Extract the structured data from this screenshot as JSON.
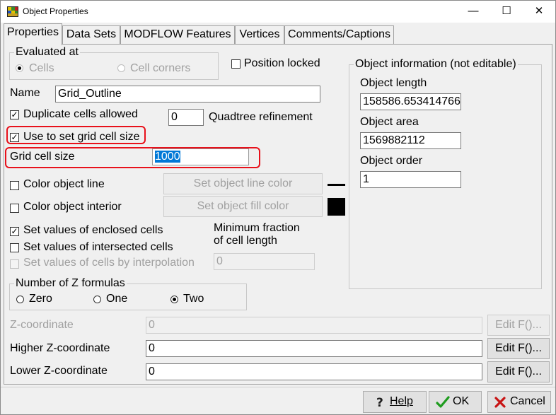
{
  "window": {
    "title": "Object Properties",
    "minimize": "—",
    "maximize": "☐",
    "close": "✕"
  },
  "tabs": [
    "Properties",
    "Data Sets",
    "MODFLOW Features",
    "Vertices",
    "Comments/Captions"
  ],
  "evaluated_at": {
    "title": "Evaluated at",
    "option_cells": "Cells",
    "option_corners": "Cell corners"
  },
  "position_locked": "Position locked",
  "name_label": "Name",
  "name_value": "Grid_Outline",
  "duplicate_cells": "Duplicate cells allowed",
  "quadtree_value": "0",
  "quadtree_label": "Quadtree refinement",
  "use_grid_cell_size": "Use to set grid cell size",
  "grid_cell_size_label": "Grid cell size",
  "grid_cell_size_value": "1000",
  "color_line_label": "Color object line",
  "set_line_color": "Set object line color",
  "color_interior_label": "Color object interior",
  "set_fill_color": "Set object fill color",
  "set_enclosed": "Set values of enclosed cells",
  "set_intersected": "Set values of intersected cells",
  "set_interpolation": "Set values of cells by interpolation",
  "min_fraction_label_1": "Minimum fraction",
  "min_fraction_label_2": "of cell length",
  "min_fraction_value": "0",
  "z_formulas": {
    "title": "Number of Z formulas",
    "zero": "Zero",
    "one": "One",
    "two": "Two"
  },
  "z_coord_label": "Z-coordinate",
  "z_coord_value": "0",
  "higher_z_label": "Higher Z-coordinate",
  "higher_z_value": "0",
  "lower_z_label": "Lower Z-coordinate",
  "lower_z_value": "0",
  "edit_f": "Edit F()...",
  "object_info": {
    "title": "Object information (not editable)",
    "length_label": "Object length",
    "length_value": "158586.653414766",
    "area_label": "Object area",
    "area_value": "1569882112",
    "order_label": "Object order",
    "order_value": "1"
  },
  "buttons": {
    "help": "Help",
    "ok": "OK",
    "cancel": "Cancel"
  },
  "colors": {
    "highlight_red": "#e8111b",
    "ok_check_green": "#1e9c1e",
    "cancel_x_red": "#c81414",
    "selection_blue": "#0078d7"
  }
}
